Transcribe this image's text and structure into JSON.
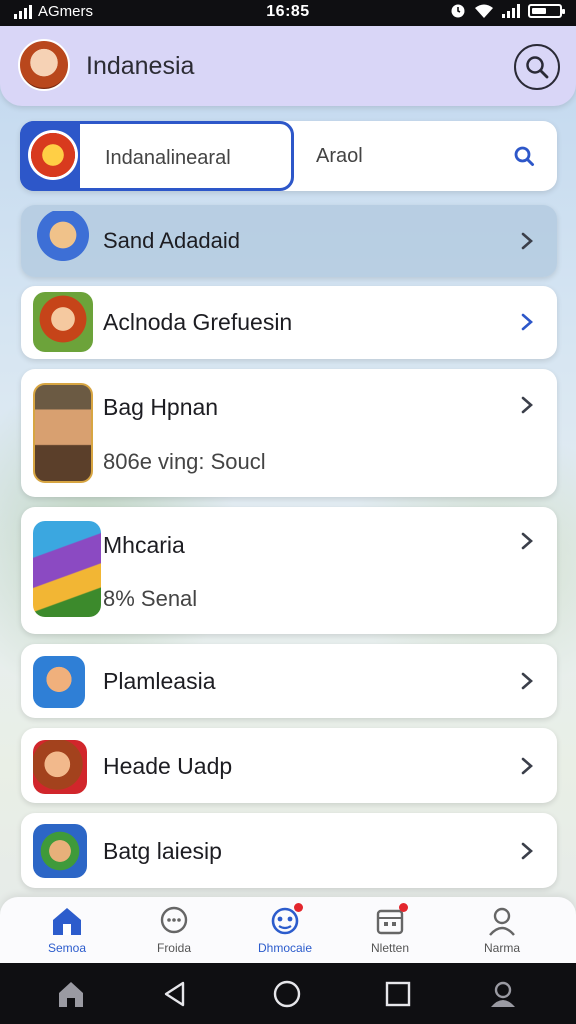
{
  "status_bar": {
    "carrier": "AGmers",
    "time": "16:85"
  },
  "header": {
    "title": "Indanesia"
  },
  "search": {
    "category_label": "Indanalinearal",
    "field_text": "Araol"
  },
  "list": [
    {
      "title": "Sand Adadaid",
      "subtitle": "",
      "selected": true
    },
    {
      "title": "Aclnoda Grefuesin",
      "subtitle": ""
    },
    {
      "title": "Bag Hpnan",
      "subtitle": "806e ving: Soucl"
    },
    {
      "title": "Mhcaria",
      "subtitle": "8% Senal"
    },
    {
      "title": "Plamleasia",
      "subtitle": ""
    },
    {
      "title": "Heade Uadp",
      "subtitle": ""
    },
    {
      "title": "Batg laiesip",
      "subtitle": ""
    }
  ],
  "bottom_nav": [
    {
      "label": "Semoa",
      "icon": "home-icon",
      "active": true
    },
    {
      "label": "Froida",
      "icon": "chat-icon"
    },
    {
      "label": "Dhmocaie",
      "icon": "game-icon",
      "badge": true
    },
    {
      "label": "Nletten",
      "icon": "calendar-icon",
      "badge": true
    },
    {
      "label": "Narma",
      "icon": "profile-icon"
    }
  ],
  "colors": {
    "accent": "#2d57c9",
    "header_bg": "#d9d6f7",
    "badge": "#e3262d"
  }
}
